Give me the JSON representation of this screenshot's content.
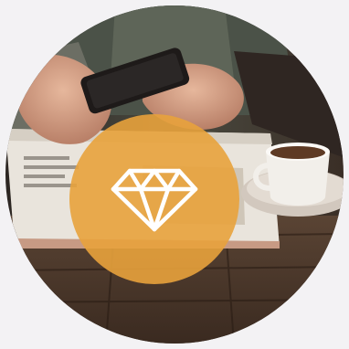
{
  "colors": {
    "page_background": "#f3f2f4",
    "badge_fill": "#e8a23c",
    "icon_stroke": "#ffffff"
  },
  "badge": {
    "opacity": 0.9,
    "icon": "diamond-icon"
  },
  "photo": {
    "icon": "hands-phone-magazine-coffee-photo"
  }
}
